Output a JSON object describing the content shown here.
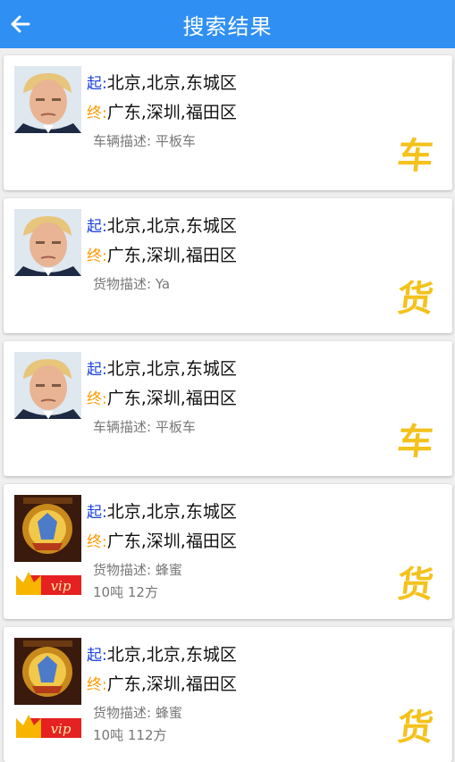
{
  "header": {
    "title": "搜索结果",
    "back_icon": "arrow-left-icon"
  },
  "colors": {
    "header_bg": "#2f8ff2",
    "start_label": "#1a3fe0",
    "end_label": "#ff9900",
    "badge": "#f4c21c"
  },
  "results": [
    {
      "avatar": "person-avatar",
      "start_label": "起:",
      "start": "北京,北京,东城区",
      "end_label": "终:",
      "end": "广东,深圳,福田区",
      "desc": "车辆描述: 平板车",
      "extra": "",
      "badge": "车",
      "vip": false
    },
    {
      "avatar": "person-avatar",
      "start_label": "起:",
      "start": "北京,北京,东城区",
      "end_label": "终:",
      "end": "广东,深圳,福田区",
      "desc": "货物描述: Ya",
      "extra": "",
      "badge": "货",
      "vip": false
    },
    {
      "avatar": "person-avatar",
      "start_label": "起:",
      "start": "北京,北京,东城区",
      "end_label": "终:",
      "end": "广东,深圳,福田区",
      "desc": "车辆描述: 平板车",
      "extra": "",
      "badge": "车",
      "vip": false
    },
    {
      "avatar": "emblem-avatar",
      "start_label": "起:",
      "start": "北京,北京,东城区",
      "end_label": "终:",
      "end": "广东,深圳,福田区",
      "desc": "货物描述: 蜂蜜",
      "extra": "10吨 12方",
      "badge": "货",
      "vip": true,
      "vip_label": "vip"
    },
    {
      "avatar": "emblem-avatar",
      "start_label": "起:",
      "start": "北京,北京,东城区",
      "end_label": "终:",
      "end": "广东,深圳,福田区",
      "desc": "货物描述: 蜂蜜",
      "extra": "10吨 112方",
      "badge": "货",
      "vip": true,
      "vip_label": "vip"
    }
  ]
}
